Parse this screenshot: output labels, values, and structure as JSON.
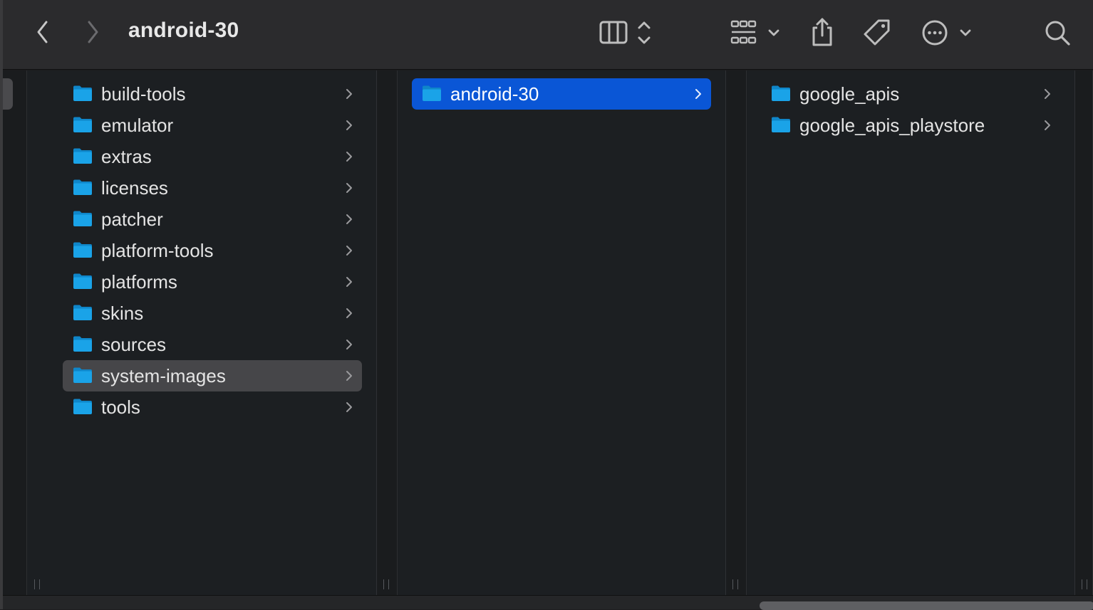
{
  "window": {
    "title": "android-30"
  },
  "toolbar": {
    "back_icon": "chevron-left-icon",
    "forward_icon": "chevron-right-icon",
    "view_mode_icon": "columns-view-icon",
    "group_icon": "grid-group-icon",
    "share_icon": "share-icon",
    "tag_icon": "tag-icon",
    "more_icon": "ellipsis-circle-icon",
    "search_icon": "search-icon"
  },
  "columns": [
    {
      "items": [
        {
          "label": "build-tools",
          "selected": false
        },
        {
          "label": "emulator",
          "selected": false
        },
        {
          "label": "extras",
          "selected": false
        },
        {
          "label": "licenses",
          "selected": false
        },
        {
          "label": "patcher",
          "selected": false
        },
        {
          "label": "platform-tools",
          "selected": false
        },
        {
          "label": "platforms",
          "selected": false
        },
        {
          "label": "skins",
          "selected": false
        },
        {
          "label": "sources",
          "selected": false
        },
        {
          "label": "system-images",
          "selected": "inactive"
        },
        {
          "label": "tools",
          "selected": false
        }
      ]
    },
    {
      "items": [
        {
          "label": "android-30",
          "selected": "active"
        }
      ]
    },
    {
      "items": [
        {
          "label": "google_apis",
          "selected": false
        },
        {
          "label": "google_apis_playstore",
          "selected": false
        }
      ]
    }
  ],
  "colors": {
    "folder": "#1aa3e8",
    "selection_active": "#0a56d6",
    "selection_inactive": "#464649"
  }
}
